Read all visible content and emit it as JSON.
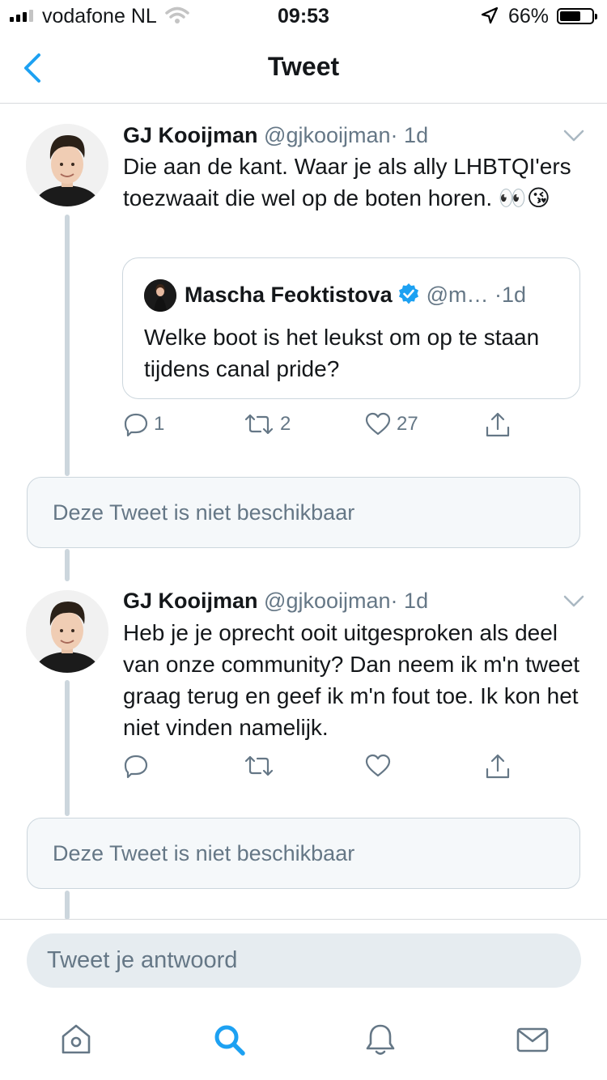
{
  "status_bar": {
    "carrier": "vodafone NL",
    "time": "09:53",
    "battery_percent": "66%",
    "battery_level": 0.66,
    "signal_bars": 3,
    "signal_bars_total": 4
  },
  "header": {
    "title": "Tweet",
    "back_icon": "chevron-left-icon"
  },
  "tweets": [
    {
      "name": "GJ Kooijman",
      "handle": "@gjkooijman",
      "sep": "·",
      "time": "1d",
      "text": "Die aan de kant. Waar je als ally LHBTQI'ers toezwaait die wel op de boten horen. 👀😘",
      "quoted": {
        "name": "Mascha Feoktistova",
        "handle": "@m…",
        "sep": "·",
        "time": "1d",
        "text": "Welke boot is het leukst om op te staan tijdens canal pride?"
      },
      "actions": {
        "replies": "1",
        "retweets": "2",
        "likes": "27"
      }
    },
    {
      "name": "GJ Kooijman",
      "handle": "@gjkooijman",
      "sep": "·",
      "time": "1d",
      "text": "Heb je je oprecht ooit uitgesproken als deel van onze community? Dan neem ik m'n tweet graag terug en geef ik m'n fout toe. Ik kon het niet vinden namelijk.",
      "actions": {
        "replies": "",
        "retweets": "",
        "likes": ""
      }
    }
  ],
  "unavailable": [
    "Deze Tweet is niet beschikbaar",
    "Deze Tweet is niet beschikbaar"
  ],
  "composer": {
    "placeholder": "Tweet je antwoord"
  },
  "tabbar": [
    "home-icon",
    "search-icon",
    "notifications-icon",
    "messages-icon"
  ],
  "colors": {
    "accent": "#1da1f2",
    "muted": "#657786",
    "border": "#ccd6dd"
  }
}
